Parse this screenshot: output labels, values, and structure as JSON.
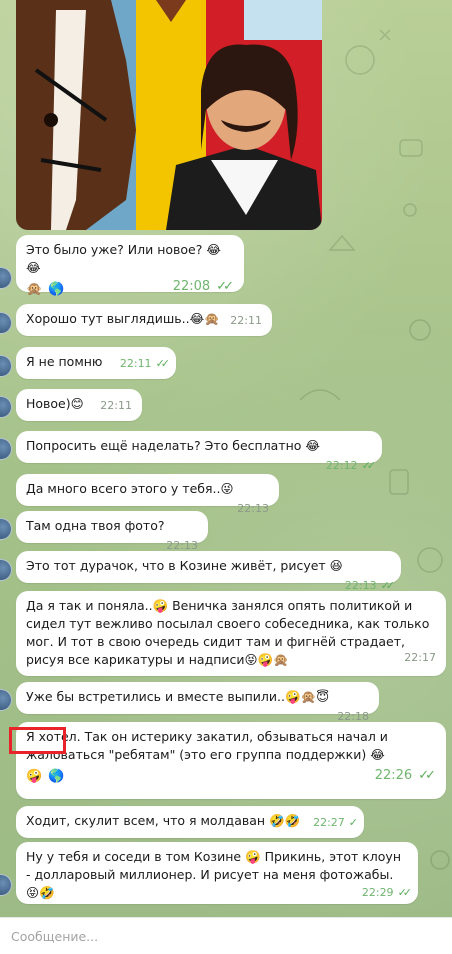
{
  "composer": {
    "placeholder": "Сообщение..."
  },
  "messages": [
    {
      "text": "Это было уже? Или новое? 😂😂",
      "time": "22:08",
      "read": true,
      "reactions": [
        "🙊",
        "🌎"
      ]
    },
    {
      "text": "Хорошо тут выглядишь..😂🙊",
      "time": "22:11",
      "read": false
    },
    {
      "text": "Я не помню",
      "time": "22:11",
      "read": true
    },
    {
      "text": "Новое)😊",
      "time": "22:11",
      "read": false
    },
    {
      "text": "Попросить ещё наделать? Это бесплатно 😂",
      "time": "22:12",
      "read": true
    },
    {
      "text": "Да много всего этого у тебя..😜",
      "time": "22:13",
      "read": false
    },
    {
      "text": "Там одна твоя фото?",
      "time": "22:13",
      "read": false
    },
    {
      "text": "Это тот дурачок, что в Козине живёт, рисует 😆",
      "time": "22:13",
      "read": true
    },
    {
      "text": "Да я так и поняла..🤪 Веничка занялся опять политикой и сидел тут вежливо посылал своего собеседника, как только мог. И тот в свою очередь сидит там и фигнёй страдает, рисуя все карикатуры и надписи😝🤪🙊",
      "time": "22:17",
      "read": false
    },
    {
      "text": "Уже бы встретились и вместе выпили..🤪🙊😇",
      "time": "22:18",
      "read": false
    },
    {
      "text": "Я хотел. Так он истерику закатил, обзываться начал и жаловаться \"ребятам\" (это его группа поддержки) 😂",
      "time": "22:26",
      "read": true,
      "reactions": [
        "🤪",
        "🌎"
      ]
    },
    {
      "text": "Ходит, скулит всем, что я молдаван 🤣🤣",
      "time": "22:27",
      "read": true
    },
    {
      "text": "Ну у тебя и соседи в том Козине 🤪 Прикинь, этот клоун - долларовый миллионер. И рисует на меня фотожабы. 😝🤣",
      "time": "22:29",
      "read": true
    }
  ]
}
